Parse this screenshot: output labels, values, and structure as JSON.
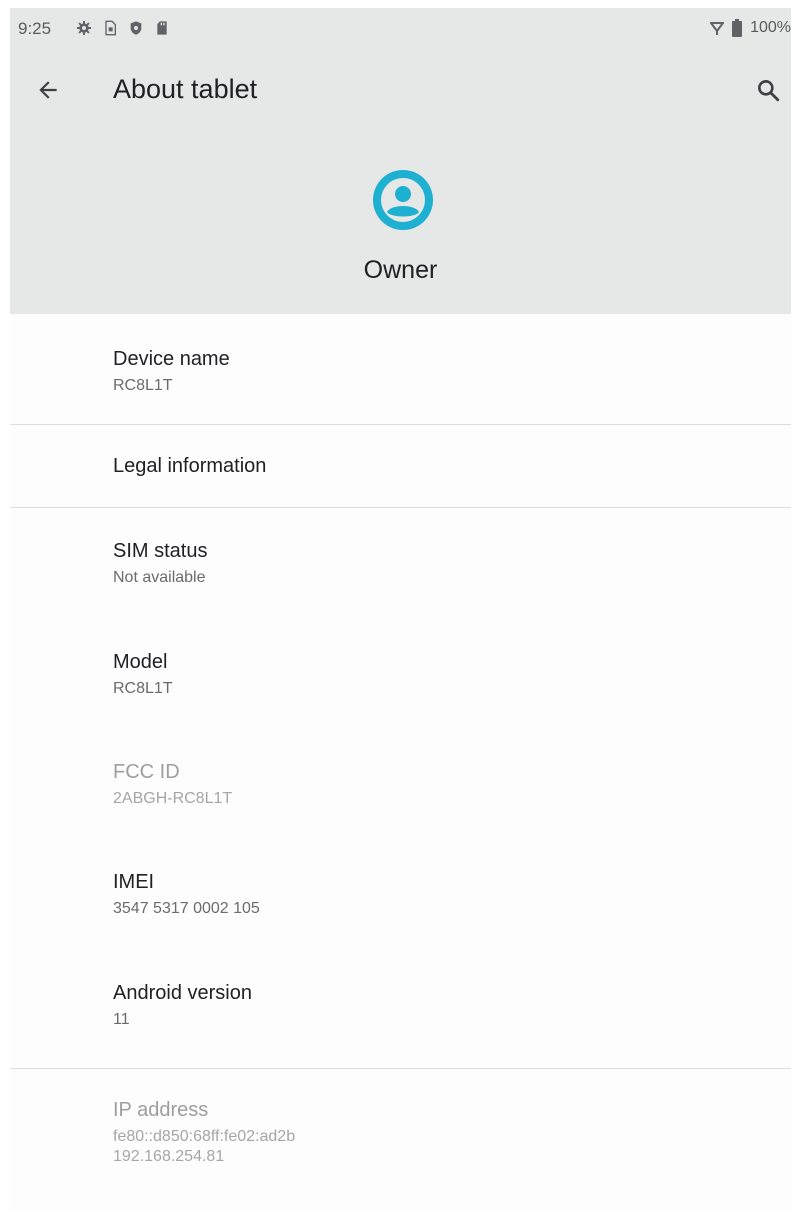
{
  "status_bar": {
    "time": "9:25",
    "icons": [
      "settings-gear-icon",
      "sim-card-icon",
      "shield-icon",
      "sd-card-icon"
    ],
    "battery_text": "100%"
  },
  "toolbar": {
    "title": "About tablet",
    "back_icon": "arrow-back-icon",
    "search_icon": "search-icon"
  },
  "profile": {
    "name": "Owner",
    "avatar_color": "#1db0d0"
  },
  "items": [
    {
      "title": "Device name",
      "summary": "RC8L1T"
    },
    {
      "title": "Legal information",
      "summary": ""
    },
    {
      "title": "SIM status",
      "summary": "Not available"
    },
    {
      "title": "Model",
      "summary": "RC8L1T"
    },
    {
      "title": "FCC ID",
      "summary": "2ABGH-RC8L1T"
    },
    {
      "title": "IMEI",
      "summary": "3547 5317 0002 105"
    },
    {
      "title": "Android version",
      "summary": "11"
    },
    {
      "title": "IP address",
      "summary": "fe80::d850:68ff:fe02:ad2b",
      "summary2": "192.168.254.81"
    }
  ]
}
